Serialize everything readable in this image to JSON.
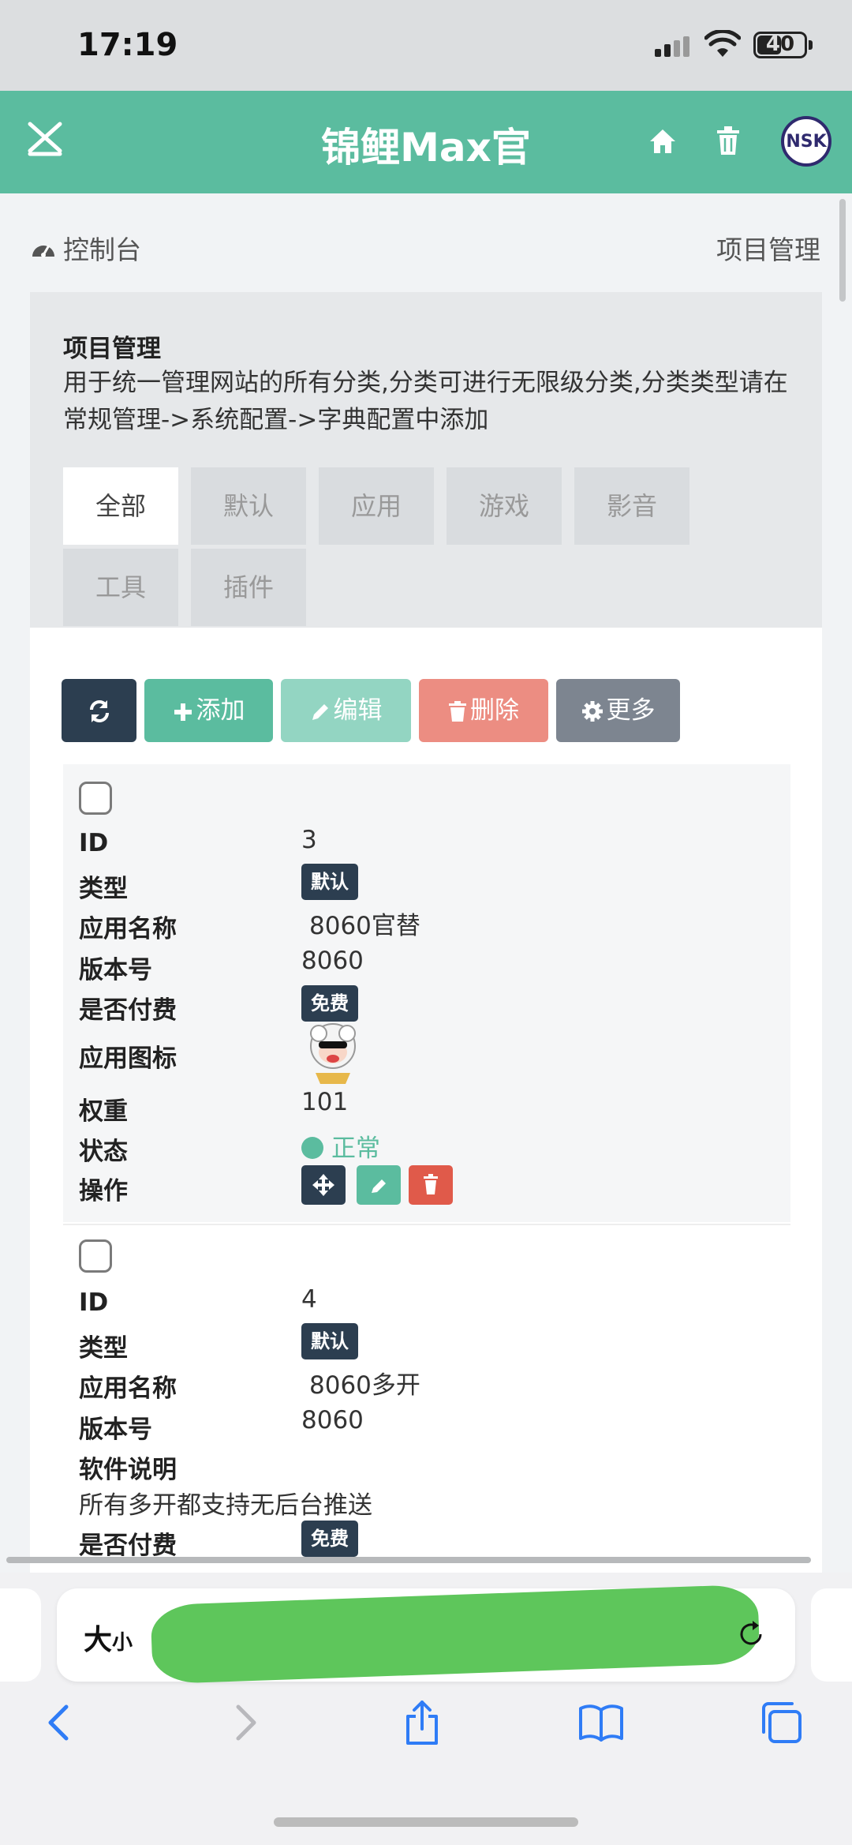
{
  "status_bar": {
    "time": "17:19",
    "battery": "40"
  },
  "header": {
    "title": "锦鲤Max官",
    "logo_text": "NSK"
  },
  "breadcrumb": {
    "left": "控制台",
    "right": "项目管理"
  },
  "panel": {
    "title": "项目管理",
    "description": "用于统一管理网站的所有分类,分类可进行无限级分类,分类类型请在常规管理->系统配置->字典配置中添加",
    "tabs": [
      "全部",
      "默认",
      "应用",
      "游戏",
      "影音",
      "工具",
      "插件"
    ],
    "active_tab": "全部"
  },
  "toolbar": {
    "add_label": "添加",
    "edit_label": "编辑",
    "delete_label": "删除",
    "more_label": "更多"
  },
  "labels": {
    "id": "ID",
    "type": "类型",
    "app_name": "应用名称",
    "version": "版本号",
    "is_paid": "是否付费",
    "app_icon": "应用图标",
    "weight": "权重",
    "status": "状态",
    "actions": "操作",
    "software_desc": "软件说明"
  },
  "rows": [
    {
      "id": "3",
      "type": "默认",
      "app_name": "8060官替",
      "version": "8060",
      "paid": "免费",
      "weight": "101",
      "status": "正常"
    },
    {
      "id": "4",
      "type": "默认",
      "app_name": "8060多开",
      "version": "8060",
      "description": "所有多开都支持无后台推送",
      "paid": "免费"
    }
  ],
  "safari": {
    "text_size_label": "大",
    "text_size_small": "小"
  },
  "colors": {
    "primary": "#5bbc9f",
    "dark": "#2c3e50",
    "danger": "#e05a4a"
  }
}
